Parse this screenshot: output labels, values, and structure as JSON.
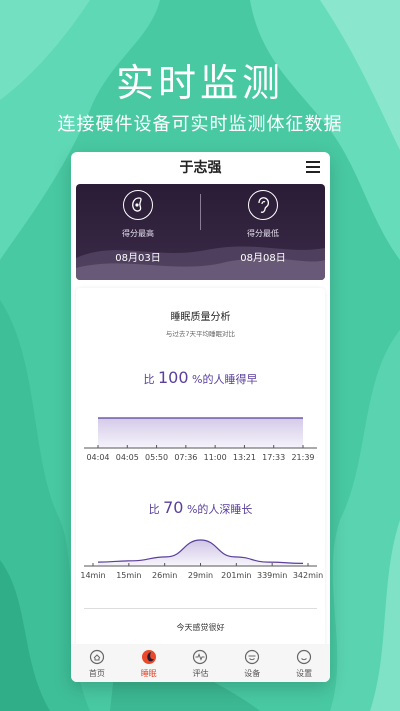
{
  "hero": {
    "title": "实时监测",
    "subtitle": "连接硬件设备可实时监测体征数据"
  },
  "app": {
    "title": "于志强",
    "menu_icon": "menu-icon"
  },
  "summary": {
    "left": {
      "icon": "sleep-icon",
      "label": "得分最高",
      "date": "08月03日"
    },
    "right": {
      "icon": "ear-icon",
      "label": "得分最低",
      "date": "08月08日"
    }
  },
  "analysis": {
    "title": "睡眠质量分析",
    "subtitle": "与过去7天平均睡眠对比",
    "stat1": {
      "prefix": "比 ",
      "value": "100",
      "suffix": " %的人睡得早"
    },
    "stat2": {
      "prefix": "比 ",
      "value": "70",
      "suffix": " %的人深睡长"
    },
    "feeling": "今天感觉很好"
  },
  "chart_data": [
    {
      "type": "area",
      "categories": [
        "04:04",
        "04:05",
        "05:50",
        "07:36",
        "11:00",
        "13:21",
        "17:33",
        "21:39"
      ],
      "values": [
        1,
        1,
        1,
        1,
        1,
        1,
        1,
        1
      ]
    },
    {
      "type": "area",
      "categories": [
        "14min",
        "15min",
        "26min",
        "29min",
        "201min",
        "339min",
        "342min"
      ],
      "values": [
        0.15,
        0.2,
        0.35,
        1.0,
        0.35,
        0.15,
        0.1
      ]
    }
  ],
  "tabs": [
    {
      "label": "首页",
      "icon": "home-icon",
      "active": false
    },
    {
      "label": "睡眠",
      "icon": "moon-icon",
      "active": true
    },
    {
      "label": "评估",
      "icon": "pulse-icon",
      "active": false
    },
    {
      "label": "设备",
      "icon": "device-icon",
      "active": false
    },
    {
      "label": "设置",
      "icon": "face-icon",
      "active": false
    }
  ],
  "colors": {
    "accent": "#5a3f9c",
    "brand_bg": "#4fd1aa",
    "active_tab": "#e84a2a"
  }
}
